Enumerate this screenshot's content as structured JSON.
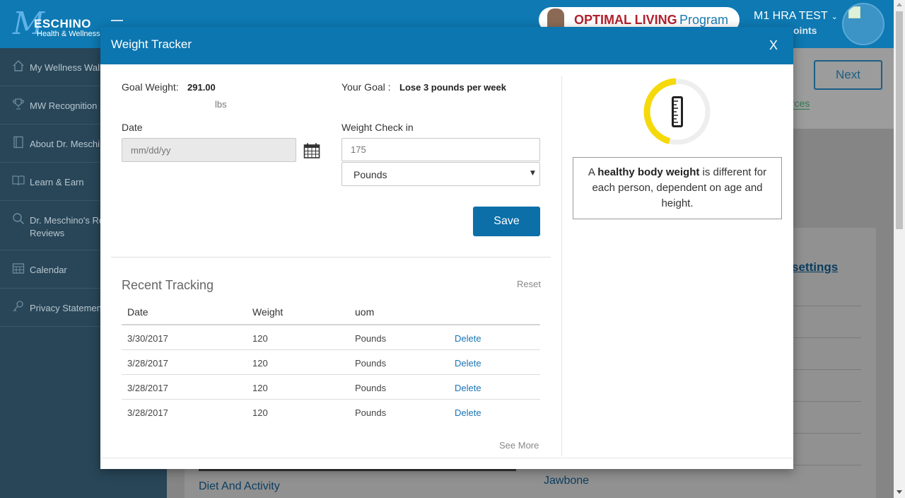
{
  "header": {
    "logo_text": "ESCHINO",
    "logo_sub": "Health & Wellness",
    "promo_text_1": "OPTIMAL LIVING",
    "promo_text_2": "Program",
    "user_name": "M1 HRA TEST",
    "user_points": "oints"
  },
  "sidebar": {
    "items": [
      {
        "label": "My Wellness Wall",
        "icon": "home-icon"
      },
      {
        "label": "MW Recognition",
        "icon": "trophy-icon"
      },
      {
        "label": "About Dr. Meschi",
        "icon": "book-icon"
      },
      {
        "label": "Learn & Earn",
        "icon": "open-book-icon"
      },
      {
        "label": "Dr. Meschino's Re",
        "label2": "Reviews",
        "icon": "search-icon"
      },
      {
        "label": "Calendar",
        "icon": "calendar-icon"
      },
      {
        "label": "Privacy Statemen",
        "icon": "key-icon"
      }
    ]
  },
  "background": {
    "next_label": "Next",
    "resources_link": "urces",
    "sync_link": "ync settings",
    "diet_label": "Diet And Activity",
    "jawbone_label": "Jawbone"
  },
  "modal": {
    "title": "Weight Tracker",
    "close_label": "X",
    "goal_weight_label": "Goal Weight:",
    "goal_weight_value": "291.00",
    "goal_weight_unit": "lbs",
    "your_goal_label": "Your Goal :",
    "your_goal_value": "Lose 3 pounds per week",
    "date_label": "Date",
    "date_placeholder": "mm/dd/yy",
    "weight_checkin_label": "Weight Check in",
    "weight_placeholder": "175",
    "unit_selected": "Pounds",
    "save_label": "Save",
    "recent_title": "Recent Tracking",
    "reset_label": "Reset",
    "table": {
      "headers": [
        "Date",
        "Weight",
        "uom"
      ],
      "rows": [
        {
          "date": "3/30/2017",
          "weight": "120",
          "uom": "Pounds",
          "action": "Delete"
        },
        {
          "date": "3/28/2017",
          "weight": "120",
          "uom": "Pounds",
          "action": "Delete"
        },
        {
          "date": "3/28/2017",
          "weight": "120",
          "uom": "Pounds",
          "action": "Delete"
        },
        {
          "date": "3/28/2017",
          "weight": "120",
          "uom": "Pounds",
          "action": "Delete"
        }
      ]
    },
    "see_more_label": "See More",
    "gauge": {
      "icon": "measuring-tape-icon",
      "progress": 0.45,
      "color": "#f5d90a"
    },
    "info_pre": "A ",
    "info_bold": "healthy body weight",
    "info_post": " is different for each person, dependent on age and height."
  },
  "colors": {
    "brand_blue": "#0c76b0",
    "sidebar_bg": "#284658",
    "link_blue": "#1a74b3",
    "gauge_yellow": "#f5d90a"
  }
}
